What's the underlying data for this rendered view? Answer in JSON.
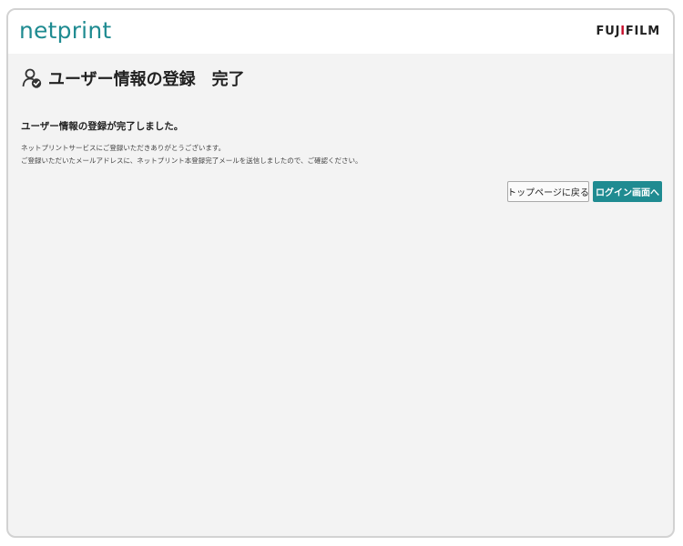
{
  "header": {
    "logo": "netprint",
    "brand_prefix": "FUJ",
    "brand_dot": "I",
    "brand_suffix": "FILM"
  },
  "page": {
    "title": "ユーザー情報の登録　完了",
    "complete_message": "ユーザー情報の登録が完了しました。",
    "note_line1": "ネットプリントサービスにご登録いただきありがとうございます。",
    "note_line2": "ご登録いただいたメールアドレスに、ネットプリント本登録完了メールを送信しましたので、ご確認ください。"
  },
  "buttons": {
    "top_page": "トップページに戻る",
    "login": "ログイン画面へ"
  },
  "colors": {
    "accent": "#1f8b91",
    "background": "#f3f3f3"
  },
  "icons": {
    "title_icon": "user-check-icon"
  }
}
